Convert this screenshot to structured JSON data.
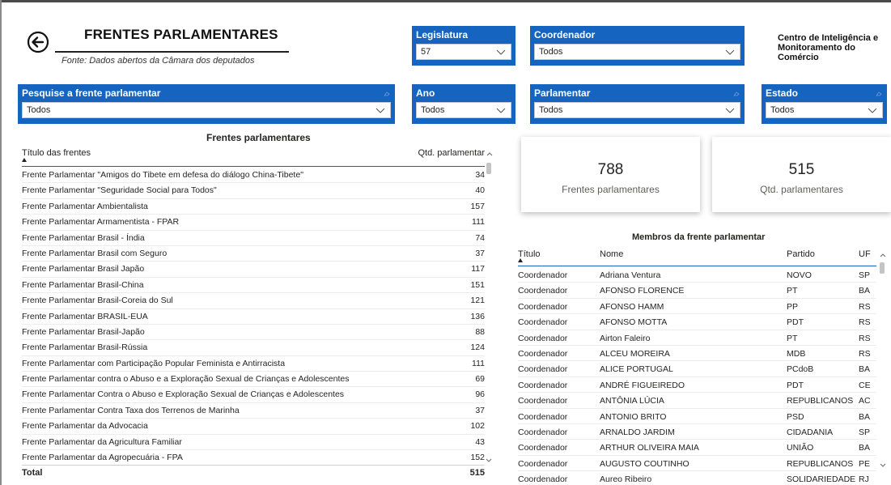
{
  "header": {
    "title": "FRENTES PARLAMENTARES",
    "subtitle": "Fonte: Dados abertos da Câmara dos deputados",
    "org_line1": "Centro de Inteligência e",
    "org_line2": "Monitoramento do Comércio",
    "back_icon": "back-arrow-circle-icon"
  },
  "slicers": {
    "legislatura": {
      "label": "Legislatura",
      "value": "57"
    },
    "coordenador": {
      "label": "Coordenador",
      "value": "Todos"
    },
    "frente": {
      "label": "Pesquise a frente parlamentar",
      "value": "Todos"
    },
    "ano": {
      "label": "Ano",
      "value": "Todos"
    },
    "parlamentar": {
      "label": "Parlamentar",
      "value": "Todos"
    },
    "estado": {
      "label": "Estado",
      "value": "Todos"
    }
  },
  "frentes_table": {
    "caption": "Frentes parlamentares",
    "col_title": "Título das frentes",
    "col_qtd": "Qtd. parlamentar",
    "rows": [
      {
        "title": "Frente Parlamentar \"Amigos do Tibete em defesa do diálogo China-Tibete\"",
        "qtd": "34"
      },
      {
        "title": "Frente Parlamentar \"Seguridade Social para Todos\"",
        "qtd": "40"
      },
      {
        "title": "Frente Parlamentar Ambientalista",
        "qtd": "157"
      },
      {
        "title": "Frente Parlamentar Armamentista - FPAR",
        "qtd": "111"
      },
      {
        "title": "Frente Parlamentar Brasil - Índia",
        "qtd": "74"
      },
      {
        "title": "Frente Parlamentar Brasil com Seguro",
        "qtd": "37"
      },
      {
        "title": "Frente Parlamentar Brasil Japão",
        "qtd": "117"
      },
      {
        "title": "Frente Parlamentar Brasil-China",
        "qtd": "151"
      },
      {
        "title": "Frente Parlamentar Brasil-Coreia do Sul",
        "qtd": "121"
      },
      {
        "title": "Frente Parlamentar BRASIL-EUA",
        "qtd": "136"
      },
      {
        "title": "Frente Parlamentar Brasil-Japão",
        "qtd": "88"
      },
      {
        "title": "Frente Parlamentar Brasil-Rússia",
        "qtd": "124"
      },
      {
        "title": "Frente Parlamentar com Participação Popular Feminista e Antirracista",
        "qtd": "111"
      },
      {
        "title": "Frente Parlamentar contra o Abuso e a Exploração Sexual de Crianças e Adolescentes",
        "qtd": "69"
      },
      {
        "title": "Frente Parlamentar Contra o Abuso e Exploração Sexual de Crianças e Adolescentes",
        "qtd": "96"
      },
      {
        "title": "Frente Parlamentar Contra Taxa dos Terrenos de Marinha",
        "qtd": "37"
      },
      {
        "title": "Frente Parlamentar da Advocacia",
        "qtd": "102"
      },
      {
        "title": "Frente Parlamentar da Agricultura Familiar",
        "qtd": "43"
      },
      {
        "title": "Frente Parlamentar da Agropecuária - FPA",
        "qtd": "152"
      }
    ],
    "total_label": "Total",
    "total_value": "515"
  },
  "cards": {
    "frentes": {
      "value": "788",
      "label": "Frentes parlamentares"
    },
    "parlamentares": {
      "value": "515",
      "label": "Qtd. parlamentares"
    }
  },
  "membros_table": {
    "caption": "Membros da frente parlamentar",
    "columns": [
      "Título",
      "Nome",
      "Partido",
      "UF"
    ],
    "rows": [
      [
        "Coordenador",
        "Adriana Ventura",
        "NOVO",
        "SP"
      ],
      [
        "Coordenador",
        "AFONSO FLORENCE",
        "PT",
        "BA"
      ],
      [
        "Coordenador",
        "AFONSO HAMM",
        "PP",
        "RS"
      ],
      [
        "Coordenador",
        "AFONSO MOTTA",
        "PDT",
        "RS"
      ],
      [
        "Coordenador",
        "Airton Faleiro",
        "PT",
        "RS"
      ],
      [
        "Coordenador",
        "ALCEU MOREIRA",
        "MDB",
        "RS"
      ],
      [
        "Coordenador",
        "ALICE PORTUGAL",
        "PCdoB",
        "BA"
      ],
      [
        "Coordenador",
        "ANDRÉ FIGUEIREDO",
        "PDT",
        "CE"
      ],
      [
        "Coordenador",
        "ANTÔNIA LÚCIA",
        "REPUBLICANOS",
        "AC"
      ],
      [
        "Coordenador",
        "ANTONIO BRITO",
        "PSD",
        "BA"
      ],
      [
        "Coordenador",
        "ARNALDO JARDIM",
        "CIDADANIA",
        "SP"
      ],
      [
        "Coordenador",
        "ARTHUR OLIVEIRA MAIA",
        "UNIÃO",
        "BA"
      ],
      [
        "Coordenador",
        "AUGUSTO COUTINHO",
        "REPUBLICANOS",
        "PE"
      ],
      [
        "Coordenador",
        "Aureo Ribeiro",
        "SOLIDARIEDADE",
        "RJ"
      ]
    ]
  },
  "colors": {
    "slicer_blue": "#1565c0",
    "text": "#252423",
    "muted": "#605e5c"
  }
}
